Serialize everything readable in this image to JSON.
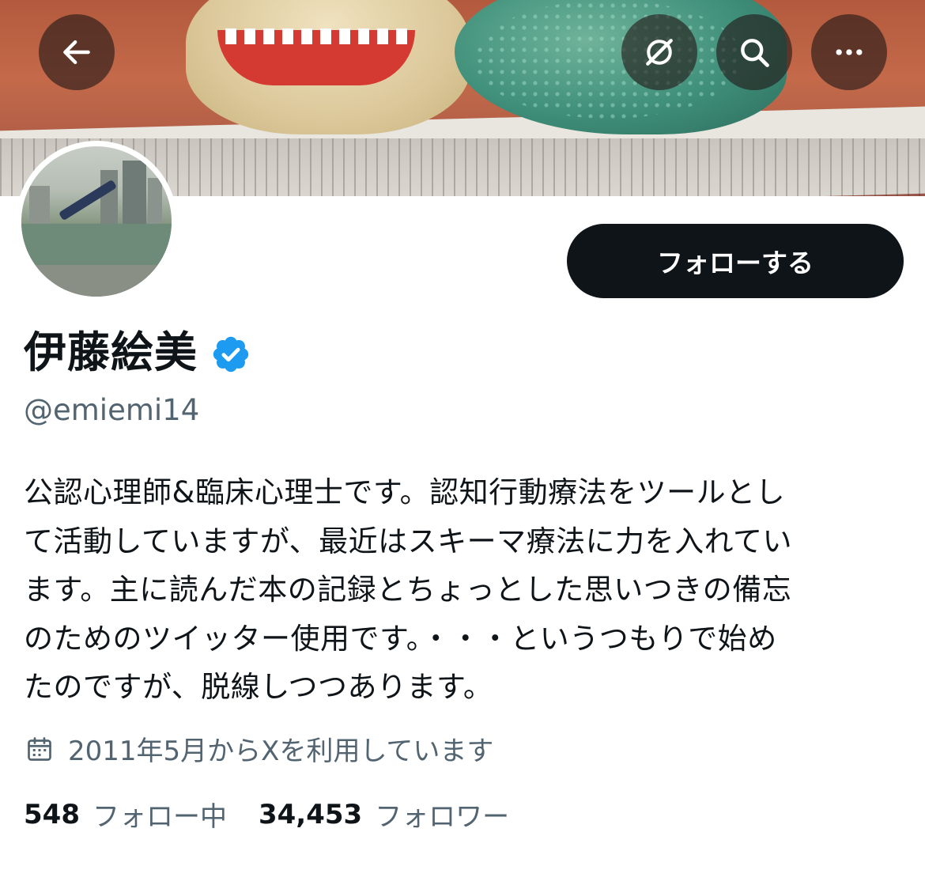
{
  "colors": {
    "text_primary": "#0f1419",
    "text_secondary": "#536471",
    "verified_blue": "#1d9bf0",
    "follow_bg": "#0f1419"
  },
  "header": {
    "back_icon": "arrow-left-icon",
    "translate_icon": "grok-slash-icon",
    "search_icon": "search-icon",
    "more_icon": "more-horizontal-icon"
  },
  "profile": {
    "follow_label": "フォローする",
    "name": "伊藤絵美",
    "verified": true,
    "handle": "@emiemi14",
    "bio_lines": [
      "公認心理師&臨床心理士です。認知行動療法をツールとし",
      "て活動していますが、最近はスキーマ療法に力を入れてい",
      "ます。主に読んだ本の記録とちょっとした思いつきの備忘",
      "のためのツイッター使用です。・・・というつもりで始め",
      "たのですが、脱線しつつあります。"
    ],
    "joined_icon": "calendar-icon",
    "joined": "2011年5月からXを利用しています",
    "following_count": "548",
    "following_label": "フォロー中",
    "followers_count": "34,453",
    "followers_label": "フォロワー"
  }
}
